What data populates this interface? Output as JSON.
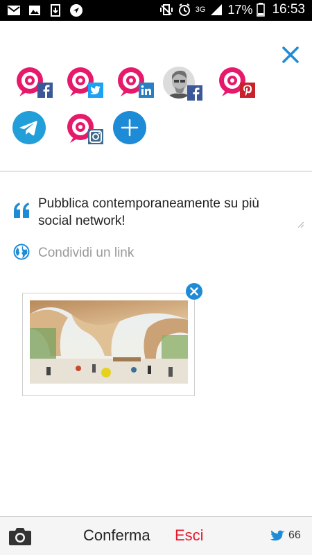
{
  "status_bar": {
    "battery": "17%",
    "time": "16:53",
    "network": "3G",
    "left_icons": [
      "mail-icon",
      "image-icon",
      "download-icon",
      "navigation-icon"
    ],
    "right_icons": [
      "vibrate-icon",
      "alarm-icon",
      "signal-icon",
      "battery-icon"
    ]
  },
  "colors": {
    "brand_pink": "#e6196b",
    "accent_blue": "#1e8bd6",
    "exit_red": "#e5192b",
    "facebook": "#3b5998",
    "twitter": "#1da1f2",
    "linkedin": "#2a7fc0",
    "pinterest": "#c8232c"
  },
  "accounts": [
    {
      "name": "account-facebook",
      "badge": "facebook"
    },
    {
      "name": "account-twitter",
      "badge": "twitter"
    },
    {
      "name": "account-linkedin",
      "badge": "linkedin"
    },
    {
      "name": "account-facebook-profile",
      "badge": "facebook"
    },
    {
      "name": "account-pinterest",
      "badge": "pinterest"
    },
    {
      "name": "account-telegram",
      "badge": ""
    },
    {
      "name": "account-instagram",
      "badge": "instagram"
    }
  ],
  "composer": {
    "text": "Pubblica contemporaneamente su più social network!",
    "link_placeholder": "Condividi un link"
  },
  "bottom_bar": {
    "confirm_label": "Conferma",
    "exit_label": "Esci",
    "char_count": "66"
  }
}
